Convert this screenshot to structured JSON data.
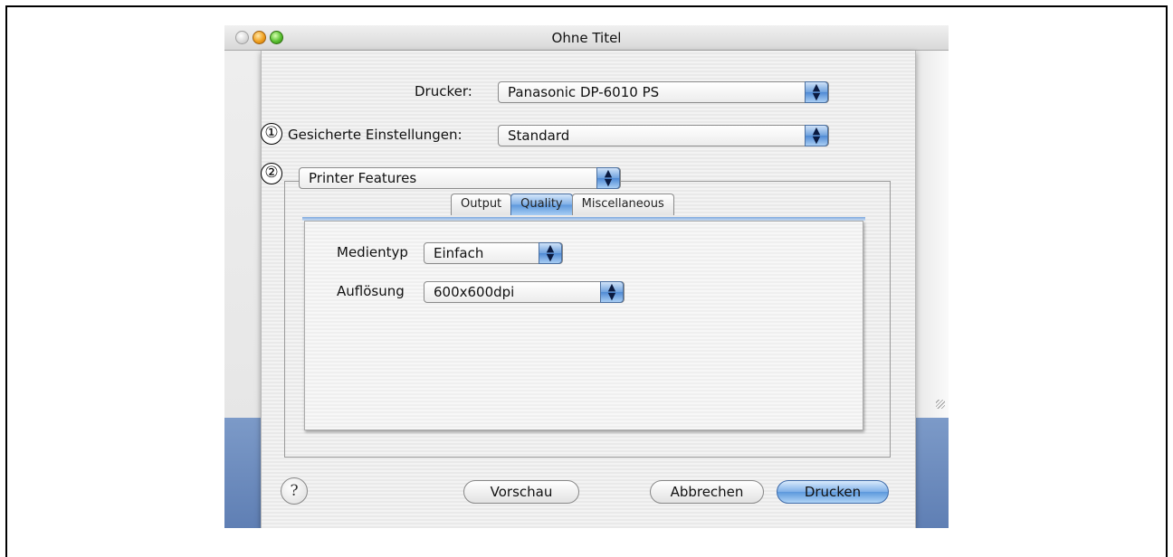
{
  "window": {
    "title": "Ohne Titel"
  },
  "printer": {
    "label": "Drucker:",
    "value": "Panasonic DP-6010 PS"
  },
  "presets": {
    "label": "Gesicherte Einstellungen:",
    "value": "Standard",
    "callout": "①"
  },
  "panel_selector": {
    "value": "Printer Features",
    "callout": "②"
  },
  "tabs": [
    {
      "label": "Output",
      "active": false
    },
    {
      "label": "Quality",
      "active": true
    },
    {
      "label": "Miscellaneous",
      "active": false
    }
  ],
  "quality": {
    "media_type_label": "Medientyp",
    "media_type_value": "Einfach",
    "resolution_label": "Auflösung",
    "resolution_value": "600x600dpi"
  },
  "buttons": {
    "help": "?",
    "preview": "Vorschau",
    "cancel": "Abbrechen",
    "print": "Drucken"
  },
  "icons": {
    "popup_arrows": "⬍"
  },
  "colors": {
    "accent": "#5e98dc",
    "desktop_blue": "#6c8cbc"
  }
}
